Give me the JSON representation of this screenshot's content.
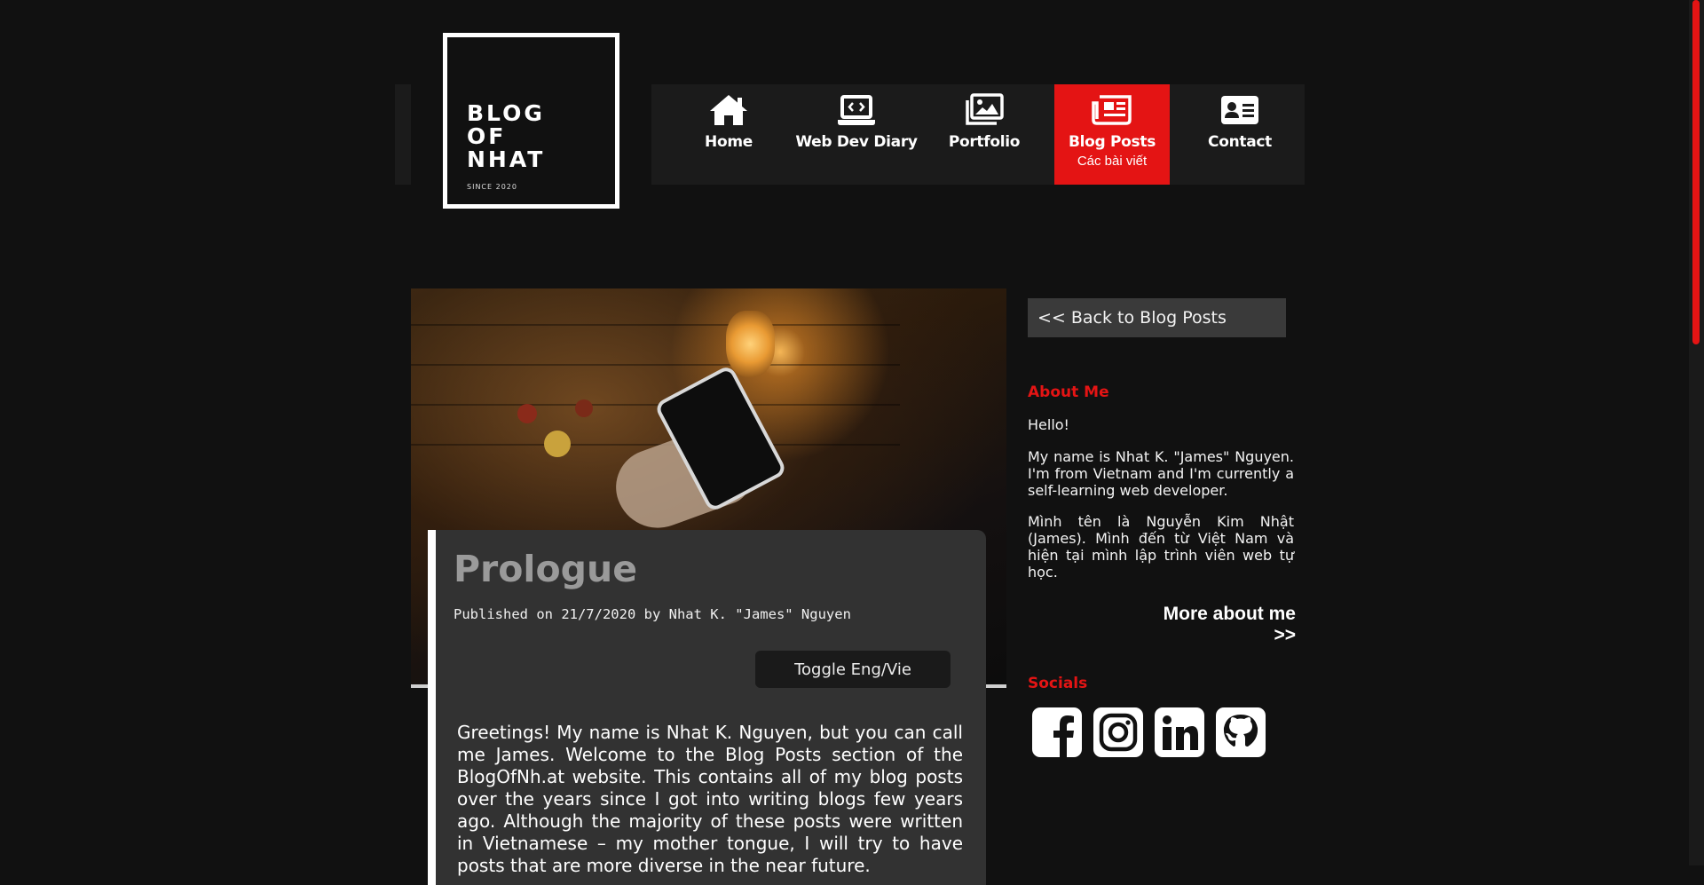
{
  "logo": {
    "title_lines": [
      "BLOG",
      "OF",
      "NHAT"
    ],
    "since": "SINCE 2020"
  },
  "nav": {
    "items": [
      {
        "label": "Home",
        "icon": "home-icon"
      },
      {
        "label": "Web Dev Diary",
        "icon": "laptop-code-icon"
      },
      {
        "label": "Portfolio",
        "icon": "images-icon"
      },
      {
        "label": "Blog Posts",
        "sub": "Các bài viết",
        "icon": "newspaper-icon",
        "active": true
      },
      {
        "label": "Contact",
        "icon": "address-card-icon"
      }
    ]
  },
  "post": {
    "title": "Prologue",
    "meta": "Published on 21/7/2020 by Nhat K. \"James\" Nguyen",
    "toggle_label": "Toggle Eng/Vie",
    "body": "Greetings! My name is Nhat K. Nguyen, but you can call me James. Welcome to the Blog Posts section of the BlogOfNh.at website. This contains all of my blog posts over the years since I got into writing blogs few years ago. Although the majority of these posts were written in Vietnamese – my mother tongue, I will try to have posts that are more diverse in the near future."
  },
  "sidebar": {
    "back_label": "<< Back to Blog Posts",
    "about_heading": "About Me",
    "about_hello": "Hello!",
    "about_en": "My name is Nhat K. \"James\" Nguyen. I'm from Vietnam and I'm currently a self-learning web developer.",
    "about_vi": "Mình tên là Nguyễn Kim Nhật (James). Mình đến từ Việt Nam và hiện tại mình lập trình viên web tự học.",
    "more_label": "More about me >>",
    "socials_heading": "Socials",
    "socials": [
      "facebook-icon",
      "instagram-icon",
      "linkedin-icon",
      "github-icon"
    ]
  },
  "colors": {
    "accent": "#e41414",
    "background": "#111111",
    "panel": "#323232"
  }
}
